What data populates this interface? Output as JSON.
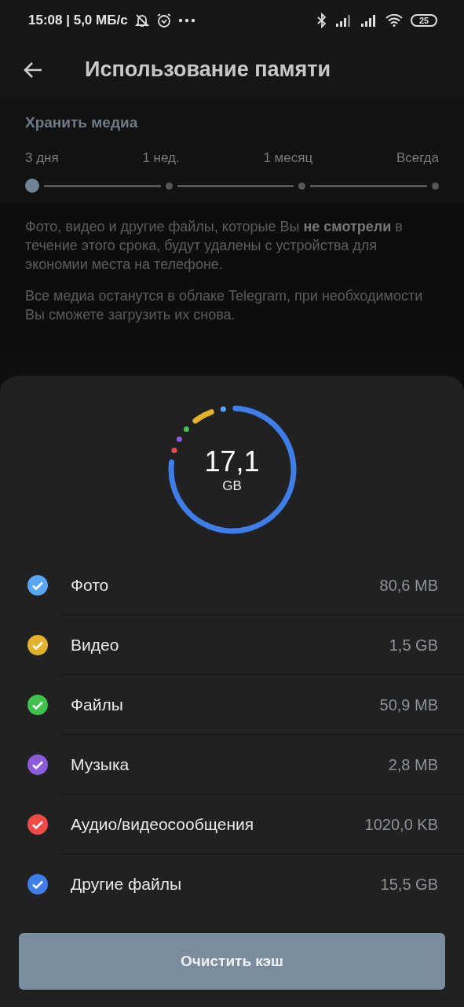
{
  "status_bar": {
    "time": "15:08 | 5,0 МБ/с",
    "battery": "25"
  },
  "header": {
    "title": "Использование памяти"
  },
  "keep_media": {
    "title": "Хранить медиа",
    "stops": [
      {
        "label": "3 дня",
        "selected": true
      },
      {
        "label": "1 нед.",
        "selected": false
      },
      {
        "label": "1 месяц",
        "selected": false
      },
      {
        "label": "Всегда",
        "selected": false
      }
    ]
  },
  "info": [
    "Фото, видео и другие файлы, которые Вы **не смотрели** в течение этого срока, будут удалены с устройства для экономии места на телефоне.",
    "Все медиа останутся в облаке Telegram, при необходимости Вы сможете загрузить их снова."
  ],
  "sheet": {
    "total": "17,1",
    "unit": "GB",
    "items": [
      {
        "label": "Фото",
        "size": "80,6 MB",
        "checked": true,
        "color": "#58a6f5"
      },
      {
        "label": "Видео",
        "size": "1,5 GB",
        "checked": true,
        "color": "#e2b22b"
      },
      {
        "label": "Файлы",
        "size": "50,9 MB",
        "checked": true,
        "color": "#3fc24b"
      },
      {
        "label": "Музыка",
        "size": "2,8 MB",
        "checked": true,
        "color": "#8b5bd9"
      },
      {
        "label": "Аудио/видеосообщения",
        "size": "1020,0 KB",
        "checked": true,
        "color": "#ef4a45"
      },
      {
        "label": "Другие файлы",
        "size": "15,5 GB",
        "checked": true,
        "color": "#3f7de8"
      }
    ],
    "button": "Очистить кэш"
  }
}
